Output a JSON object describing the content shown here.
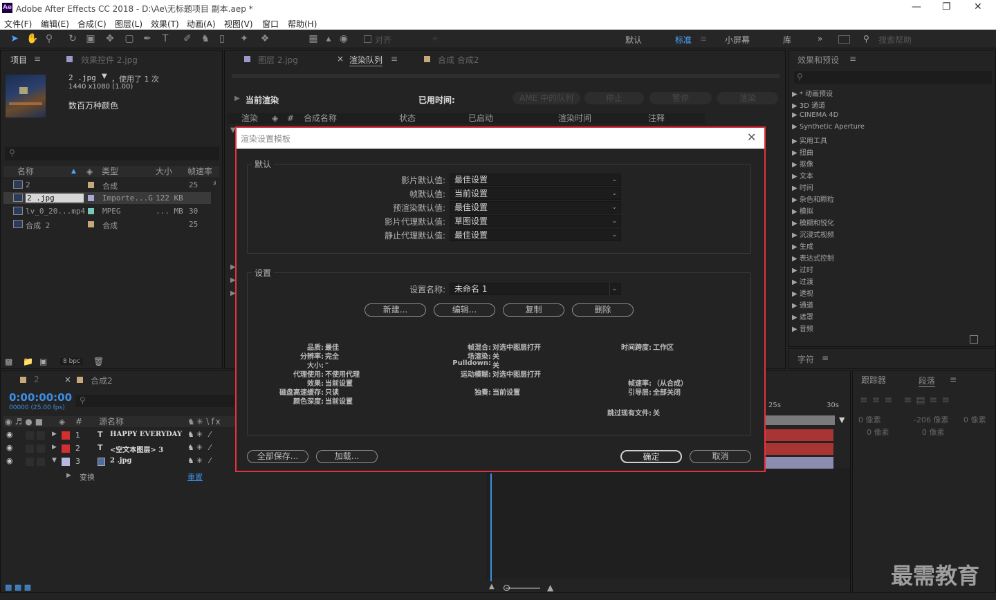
{
  "titlebar": {
    "app_title": "Adobe After Effects CC 2018 - D:\\Ae\\无标题项目 副本.aep *",
    "logo": "Ae"
  },
  "menu": [
    "文件(F)",
    "编辑(E)",
    "合成(C)",
    "图层(L)",
    "效果(T)",
    "动画(A)",
    "视图(V)",
    "窗口",
    "帮助(H)"
  ],
  "toolbar": {
    "snap_label": "对齐",
    "workspaces": [
      "默认",
      "标准",
      "小屏幕",
      "库"
    ],
    "search_placeholder": "搜索帮助"
  },
  "project": {
    "tab": "项目",
    "effects_tab": "效果控件 2.jpg",
    "item_name": "2 .jpg",
    "used": "，使用了 1 次",
    "dims": "1440 x1080 (1.00)",
    "colors": "数百万种颜色",
    "columns": [
      "名称",
      "类型",
      "大小",
      "帧速率"
    ],
    "rows": [
      {
        "name": "2",
        "type": "合成",
        "size": "",
        "fps": "25",
        "color": "#c8a878"
      },
      {
        "name": "2 .jpg",
        "type": "Importe...G",
        "size": "122 KB",
        "fps": "",
        "color": "#a8a8d8"
      },
      {
        "name": "lv_0_20...mp4",
        "type": "MPEG",
        "size": "... MB",
        "fps": "30",
        "color": "#78c8b8"
      },
      {
        "name": "合成 2",
        "type": "合成",
        "size": "",
        "fps": "25",
        "color": "#c8a878"
      }
    ],
    "bpc": "8 bpc"
  },
  "render_panel": {
    "tabs": [
      "图层 2.jpg",
      "渲染队列",
      "合成 合成2"
    ],
    "current_render": "当前渲染",
    "elapsed": "已用时间:",
    "buttons": [
      "AME 中的队列",
      "停止",
      "暂停",
      "渲染"
    ],
    "columns": [
      "渲染",
      "#",
      "合成名称",
      "状态",
      "已启动",
      "渲染时间",
      "注释"
    ]
  },
  "effects": {
    "tab": "效果和预设",
    "items": [
      "▶ * 动画预设",
      "▶ 3D 通道",
      "▶ CINEMA 4D",
      "▶ Synthetic Aperture",
      "▶ 实用工具",
      "▶ 扭曲",
      "▶ 抠像",
      "▶ 文本",
      "▶ 时间",
      "▶ 杂色和颗粒",
      "▶ 模拟",
      "▶ 模糊和锐化",
      "▶ 沉浸式视频",
      "▶ 生成",
      "▶ 表达式控制",
      "▶ 过时",
      "▶ 过渡",
      "▶ 透视",
      "▶ 通道",
      "▶ 遮罩",
      "▶ 音频"
    ],
    "char_tab": "字符",
    "tracker_tab": "跟踪器",
    "para_tab": "段落",
    "para_values": [
      "0 像素",
      "-206 像素",
      "0 像素",
      "0 像素",
      "0 像素"
    ]
  },
  "timeline": {
    "tab1": "2",
    "tab2": "合成2",
    "timecode": "0:00:00:00",
    "fps_sub": "00000 (25.00 fps)",
    "source_col": "源名称",
    "layers": [
      {
        "num": "1",
        "type": "T",
        "name": "HAPPY EVERYDAY",
        "color": "#d23030"
      },
      {
        "num": "2",
        "type": "T",
        "name": "<空文本图层> 3",
        "color": "#d23030"
      },
      {
        "num": "3",
        "type": "img",
        "name": "2 .jpg",
        "color": "#b8b8e0"
      }
    ],
    "transform": "变换",
    "reset": "重置",
    "ruler": [
      "25s",
      "30s"
    ]
  },
  "dialog": {
    "title": "渲染设置模板",
    "defaults_group": "默认",
    "defaults": [
      {
        "label": "影片默认值:",
        "value": "最佳设置"
      },
      {
        "label": "帧默认值:",
        "value": "当前设置"
      },
      {
        "label": "预渲染默认值:",
        "value": "最佳设置"
      },
      {
        "label": "影片代理默认值:",
        "value": "草图设置"
      },
      {
        "label": "静止代理默认值:",
        "value": "最佳设置"
      }
    ],
    "settings_group": "设置",
    "name_label": "设置名称:",
    "name_value": "未命名 1",
    "buttons": [
      "新建...",
      "编辑...",
      "复制",
      "删除"
    ],
    "info_col1": [
      [
        "品质:",
        "最佳"
      ],
      [
        "分辨率:",
        "完全"
      ],
      [
        "大小:",
        "–"
      ],
      [
        "代理使用:",
        "不使用代理"
      ],
      [
        "效果:",
        "当前设置"
      ],
      [
        "磁盘高速缓存:",
        "只读"
      ],
      [
        "颜色深度:",
        "当前设置"
      ]
    ],
    "info_col2": [
      [
        "帧混合:",
        "对选中图层打开"
      ],
      [
        "场渲染:",
        "关"
      ],
      [
        "Pulldown:",
        "关"
      ],
      [
        "运动模糊:",
        "对选中图层打开"
      ],
      [
        "独奏:",
        "当前设置"
      ]
    ],
    "info_col3": [
      [
        "时间跨度:",
        "工作区"
      ],
      [
        "帧速率:",
        "（从合成）"
      ],
      [
        "引导层:",
        "全部关闭"
      ],
      [
        "跳过现有文件:",
        "关"
      ]
    ],
    "save_all": "全部保存...",
    "load": "加载...",
    "ok": "确定",
    "cancel": "取消"
  },
  "watermark": "最需教育"
}
